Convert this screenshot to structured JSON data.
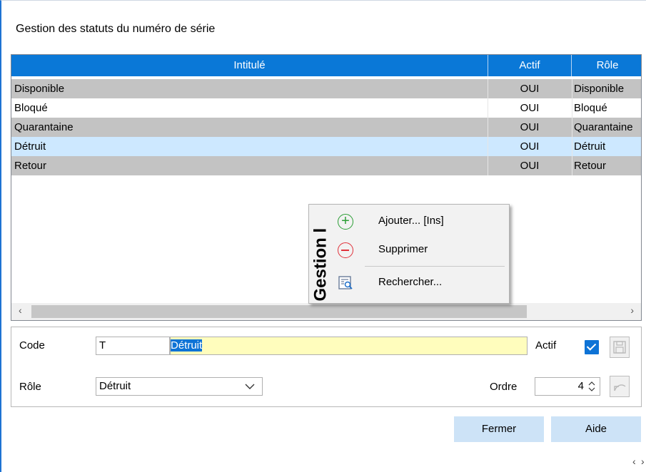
{
  "window": {
    "title": "Gestion des statuts du numéro de série"
  },
  "grid": {
    "columns": [
      "Intitulé",
      "Actif",
      "Rôle"
    ],
    "rows": [
      {
        "intitule": "Disponible",
        "actif": "OUI",
        "role": "Disponible"
      },
      {
        "intitule": "Bloqué",
        "actif": "OUI",
        "role": "Bloqué"
      },
      {
        "intitule": "Quarantaine",
        "actif": "OUI",
        "role": "Quarantaine"
      },
      {
        "intitule": "Détruit",
        "actif": "OUI",
        "role": "Détruit"
      },
      {
        "intitule": "Retour",
        "actif": "OUI",
        "role": "Retour"
      }
    ],
    "selected_row": "Détruit"
  },
  "context_menu": {
    "side_label": "Gestion l",
    "items": [
      {
        "label": "Ajouter... [Ins]",
        "icon": "add-circle-icon"
      },
      {
        "label": "Supprimer",
        "icon": "remove-circle-icon"
      },
      {
        "label": "Rechercher...",
        "icon": "search-list-icon"
      }
    ]
  },
  "form": {
    "code_label": "Code",
    "code_value": "T",
    "intitule_value": "Détruit",
    "actif_label": "Actif",
    "actif_checked": true,
    "role_label": "Rôle",
    "role_value": "Détruit",
    "ordre_label": "Ordre",
    "ordre_value": "4"
  },
  "buttons": {
    "close": "Fermer",
    "help": "Aide"
  },
  "colors": {
    "header": "#0a78d7",
    "row_gray": "#c3c3c3",
    "row_selected": "#cde8ff",
    "field_yellow": "#fffdbd",
    "button": "#cde3f7"
  }
}
